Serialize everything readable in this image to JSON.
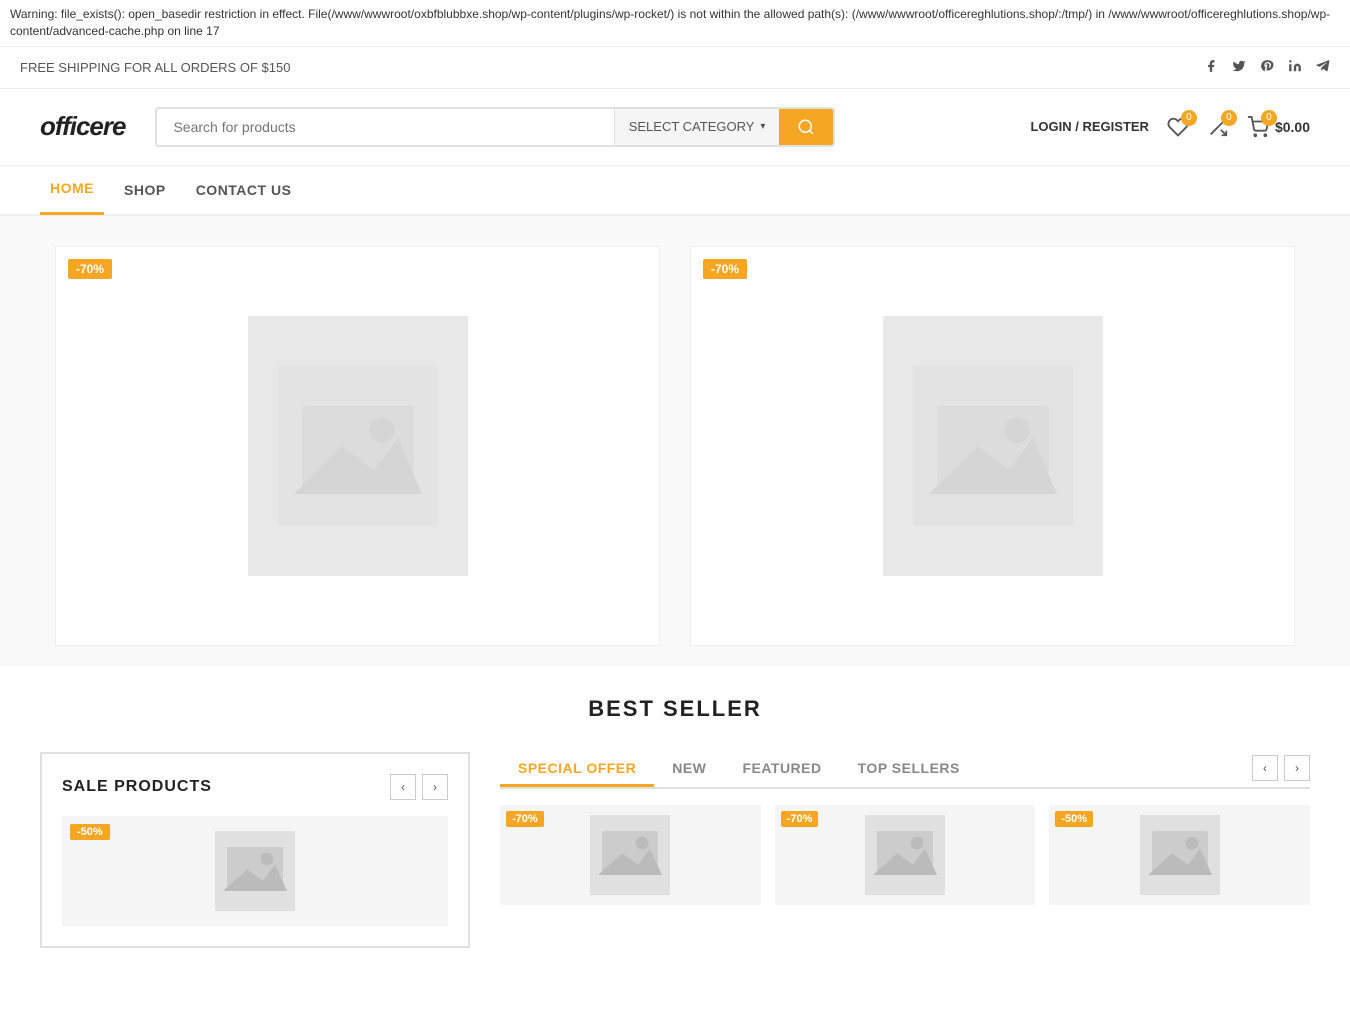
{
  "warning": {
    "text": "Warning: file_exists(): open_basedir restriction in effect. File(/www/wwwroot/oxbfblubbxe.shop/wp-content/plugins/wp-rocket/) is not within the allowed path(s): (/www/wwwroot/officereghlutions.shop/:/tmp/) in /www/wwwroot/officereghlutions.shop/wp-content/advanced-cache.php on line 17"
  },
  "topbar": {
    "shipping": "FREE SHIPPING FOR ALL ORDERS OF $150",
    "icons": [
      "f",
      "𝕏",
      "𝙥",
      "in",
      "✈"
    ]
  },
  "header": {
    "logo": "officere",
    "search_placeholder": "Search for products",
    "category_label": "SELECT CATEGORY",
    "login_label": "LOGIN / REGISTER",
    "cart_total": "$0.00"
  },
  "nav": {
    "items": [
      {
        "label": "HOME",
        "active": true
      },
      {
        "label": "SHOP",
        "active": false
      },
      {
        "label": "CONTACT US",
        "active": false
      }
    ]
  },
  "products": {
    "cards": [
      {
        "discount": "-70%"
      },
      {
        "discount": "-70%"
      }
    ]
  },
  "best_seller": {
    "title": "BEST SELLER"
  },
  "sale_products": {
    "title": "SALE PRODUCTS",
    "discount": "-50%"
  },
  "special_offer": {
    "tabs": [
      {
        "label": "SPECIAL OFFER",
        "active": true
      },
      {
        "label": "NEW",
        "active": false
      },
      {
        "label": "FEATURED",
        "active": false
      },
      {
        "label": "TOP SELLERS",
        "active": false
      }
    ],
    "thumbs": [
      {
        "discount": "-70%"
      },
      {
        "discount": "-70%"
      },
      {
        "discount": "-50%"
      }
    ]
  }
}
